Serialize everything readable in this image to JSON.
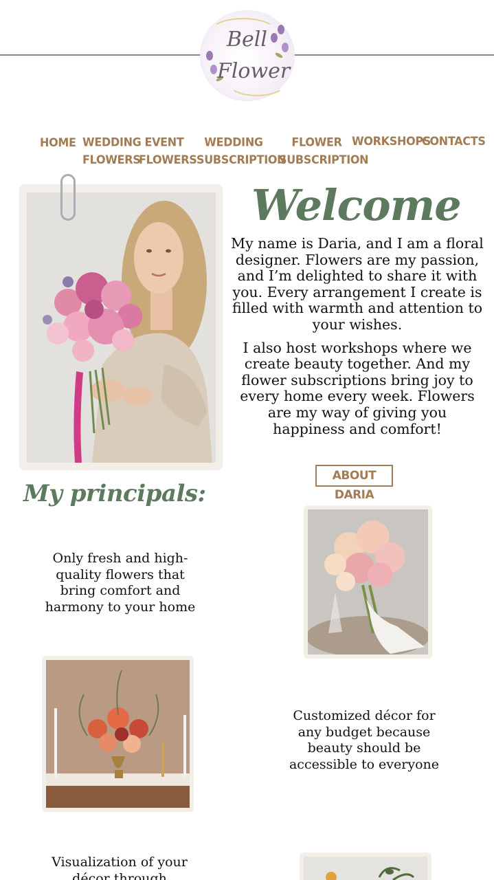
{
  "logo": {
    "line1": "Bell",
    "line2": "Flower"
  },
  "nav": {
    "items": [
      {
        "label": "HOME"
      },
      {
        "label": "WEDDING FLOWERS"
      },
      {
        "label": "EVENT FLOWERS"
      },
      {
        "label": "WEDDING SUBSCRIPTION"
      },
      {
        "label": "FLOWER SUBSCRIPTION"
      },
      {
        "label": "WORKSHOPS"
      },
      {
        "label": "CONTACTS"
      }
    ]
  },
  "welcome": {
    "title": "Welcome",
    "paragraph1": "My name is Daria, and I am a floral designer. Flowers are my passion, and I’m delighted to share it with you. Every arrangement I create is filled with warmth and attention to your wishes.",
    "paragraph2": "I also host workshops where we create beauty together. And my flower subscriptions bring joy to every home every week. Flowers are my way of giving you happiness and comfort!",
    "about_button": "ABOUT DARIA"
  },
  "principals": {
    "title": "My principals:",
    "items": [
      {
        "text": "Only fresh and high-quality flowers that bring comfort and harmony to your home"
      },
      {
        "text": "Customized décor for any budget because beauty should be accessible to everyone"
      },
      {
        "text": "Visualization of your décor through"
      }
    ]
  },
  "colors": {
    "accent_brown": "#a17c55",
    "accent_green": "#5d7a5e",
    "divider": "#8d8196",
    "frame": "#f3eee8"
  }
}
